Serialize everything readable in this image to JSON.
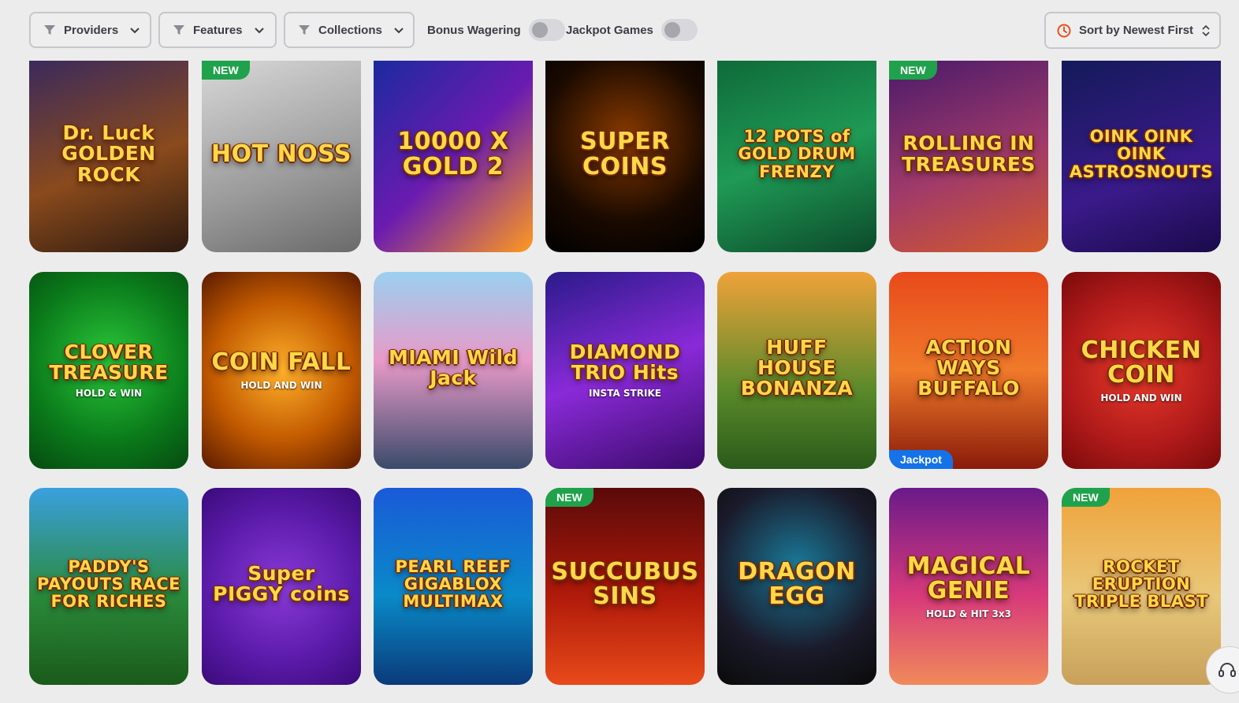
{
  "filters": {
    "providers_label": "Providers",
    "features_label": "Features",
    "collections_label": "Collections",
    "bonus_wagering_label": "Bonus Wagering",
    "bonus_wagering_on": false,
    "jackpot_games_label": "Jackpot Games",
    "jackpot_games_on": false
  },
  "sort": {
    "label": "Sort by Newest First"
  },
  "badges": {
    "new": "NEW",
    "jackpot": "Jackpot"
  },
  "colors": {
    "new_badge": "#1fa24b",
    "jackpot_badge": "#1572e8",
    "sort_icon": "#e8501e"
  },
  "games": [
    {
      "title": "Dr. Luck GOLDEN ROCK",
      "subtitle": "",
      "badge": "",
      "bg": "linear-gradient(160deg,#3b2a5c,#8a4a1c 55%,#2c1a10)"
    },
    {
      "title": "HOT NOSS",
      "subtitle": "",
      "badge": "new",
      "bg": "linear-gradient(160deg,#d8d8d8,#9a9a9a 60%,#6a6a6a)"
    },
    {
      "title": "10000 X GOLD 2",
      "subtitle": "",
      "badge": "",
      "bg": "linear-gradient(135deg,#1b2a9e,#6a1bb0 50%,#ff9a1e)"
    },
    {
      "title": "SUPER COINS",
      "subtitle": "",
      "badge": "",
      "bg": "radial-gradient(circle at 50% 40%,#8a3a00,#1a0a00 60%,#000)"
    },
    {
      "title": "12 POTS of GOLD DRUM FRENZY",
      "subtitle": "",
      "badge": "",
      "bg": "linear-gradient(160deg,#0f6a3a,#1f9a55 50%,#0c4a2a)"
    },
    {
      "title": "ROLLING IN TREASURES",
      "subtitle": "",
      "badge": "new",
      "bg": "linear-gradient(160deg,#4a1a6a,#a03a6a 55%,#d45a2a)"
    },
    {
      "title": "OINK OINK OINK ASTROSNOUTS",
      "subtitle": "",
      "badge": "",
      "bg": "linear-gradient(160deg,#141a5a,#3a1a8a 60%,#1a0a4a)"
    },
    {
      "title": "CLOVER TREASURE",
      "subtitle": "HOLD & WIN",
      "badge": "",
      "bg": "radial-gradient(circle at 50% 45%,#2ac83a,#0a7a1a 60%,#064a10)"
    },
    {
      "title": "COIN FALL",
      "subtitle": "HOLD AND WIN",
      "badge": "",
      "bg": "radial-gradient(circle at 50% 50%,#ffb02a,#c25a00 55%,#5a1a00)"
    },
    {
      "title": "MIAMI Wild Jack",
      "subtitle": "",
      "badge": "",
      "bg": "linear-gradient(180deg,#9ad0f0,#e89ac8 45%,#3a4a6a)"
    },
    {
      "title": "DIAMOND TRIO Hits",
      "subtitle": "INSTA STRIKE",
      "badge": "",
      "bg": "linear-gradient(160deg,#2a1a8a,#8a2ad8 50%,#3a0a6a)"
    },
    {
      "title": "HUFF HOUSE BONANZA",
      "subtitle": "",
      "badge": "",
      "bg": "linear-gradient(180deg,#f0a23a,#5a8a2a 60%,#2a5a1a)"
    },
    {
      "title": "ACTION WAYS BUFFALO",
      "subtitle": "",
      "badge": "jackpot",
      "bg": "linear-gradient(180deg,#e84a1a,#f07a2a 50%,#8a1a0a)"
    },
    {
      "title": "CHICKEN COIN",
      "subtitle": "HOLD AND WIN",
      "badge": "",
      "bg": "radial-gradient(circle at 50% 50%,#e83a2a,#b01a1a 60%,#7a0a0a)"
    },
    {
      "title": "PADDY'S PAYOUTS RACE FOR RICHES",
      "subtitle": "",
      "badge": "",
      "bg": "linear-gradient(180deg,#3aa0e0,#2a8a3a 55%,#1a5a1a)"
    },
    {
      "title": "Super PIGGY coins",
      "subtitle": "",
      "badge": "",
      "bg": "radial-gradient(circle at 50% 50%,#8a3ad8,#5a1aa8 60%,#3a0a7a)"
    },
    {
      "title": "PEARL REEF GIGABLOX MULTIMAX",
      "subtitle": "",
      "badge": "",
      "bg": "linear-gradient(180deg,#1a5ad8,#0a8ac8 55%,#0a3a7a)"
    },
    {
      "title": "SUCCUBUS SINS",
      "subtitle": "",
      "badge": "new",
      "bg": "linear-gradient(180deg,#5a0a0a,#b01a0a 55%,#e84a1a)"
    },
    {
      "title": "DRAGON EGG",
      "subtitle": "",
      "badge": "",
      "bg": "radial-gradient(circle at 50% 40%,#1a7a9a,#1a1a2a 60%,#0a0a0a)"
    },
    {
      "title": "MAGICAL GENIE",
      "subtitle": "HOLD & HIT 3x3",
      "badge": "",
      "bg": "linear-gradient(180deg,#6a1a8a,#d83a7a 55%,#f08a5a)"
    },
    {
      "title": "ROCKET ERUPTION TRIPLE BLAST",
      "subtitle": "",
      "badge": "new",
      "bg": "linear-gradient(180deg,#f0a23a,#e8c87a 55%,#c8a05a)"
    }
  ]
}
